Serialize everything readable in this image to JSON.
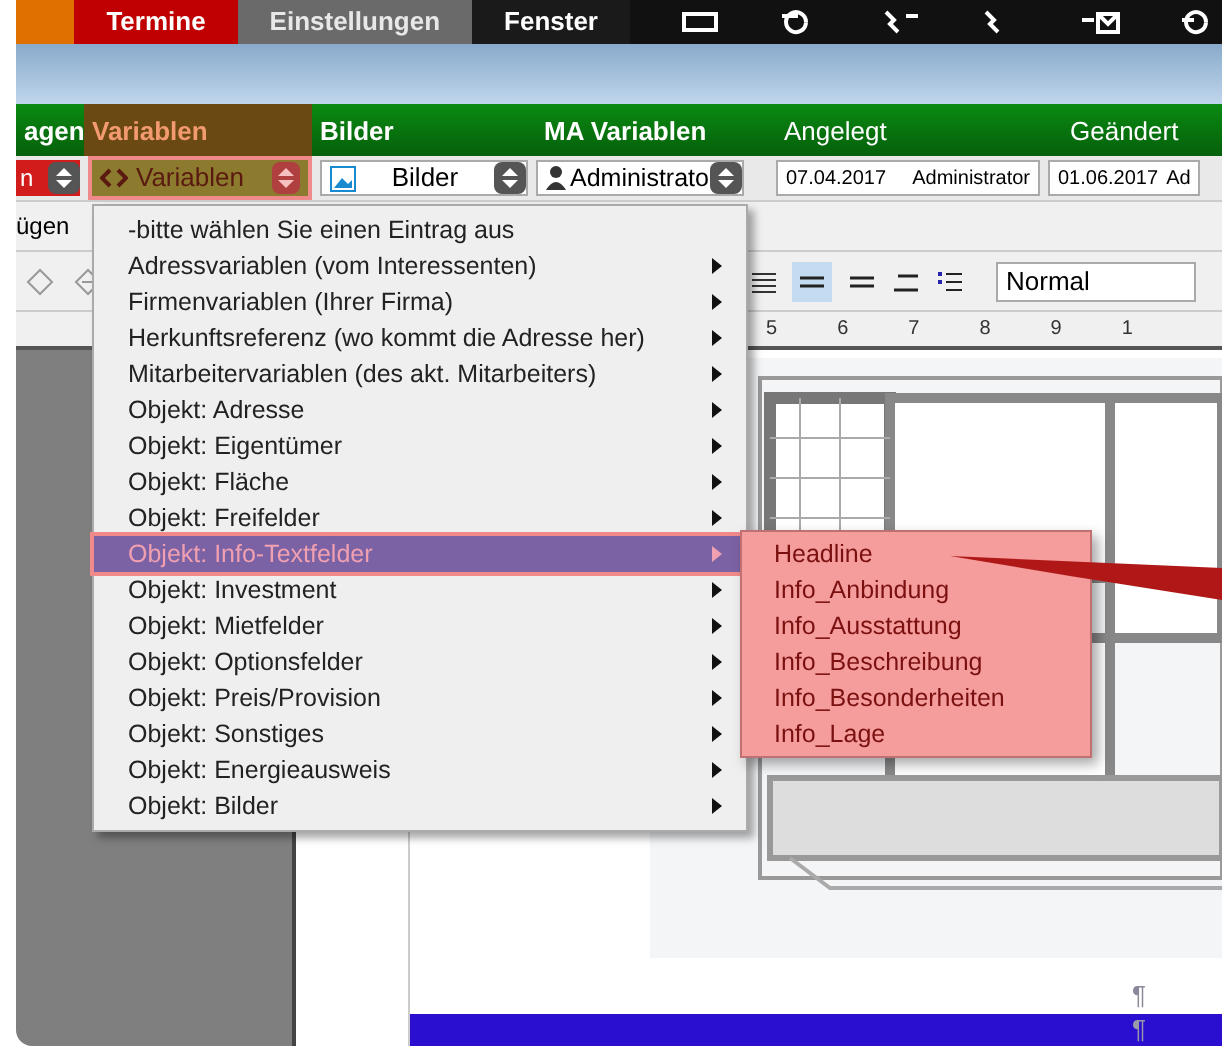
{
  "top_tabs": [
    {
      "label": "Termine",
      "kind": "red"
    },
    {
      "label": "Einstellungen",
      "kind": "gray"
    },
    {
      "label": "Fenster",
      "kind": "dark"
    }
  ],
  "column_headers": [
    {
      "label": "agen",
      "selected": false
    },
    {
      "label": "Variablen",
      "selected": true
    },
    {
      "label": "Bilder",
      "selected": false
    },
    {
      "label": "MA Variablen",
      "selected": false
    },
    {
      "label": "Angelegt",
      "selected": false
    },
    {
      "label": "Geändert",
      "selected": false
    }
  ],
  "controls": {
    "first_select": "n",
    "variables_select": "Variablen",
    "images_select": "Bilder",
    "staff_select": "Administrato",
    "created_date": "07.04.2017",
    "created_by": "Administrator",
    "changed_date": "01.06.2017",
    "changed_by": "Ad"
  },
  "toolbar": {
    "insert_label": "ügen",
    "style_field": "Normal",
    "ruler_marks": [
      "5",
      "6",
      "7",
      "8",
      "9",
      "1"
    ]
  },
  "menu": [
    {
      "label": "-bitte wählen Sie einen Eintrag aus",
      "has_submenu": false,
      "selected": false
    },
    {
      "label": "Adressvariablen (vom Interessenten)",
      "has_submenu": true,
      "selected": false
    },
    {
      "label": "Firmenvariablen (Ihrer Firma)",
      "has_submenu": true,
      "selected": false
    },
    {
      "label": "Herkunftsreferenz (wo kommt die Adresse her)",
      "has_submenu": true,
      "selected": false
    },
    {
      "label": "Mitarbeitervariablen (des akt. Mitarbeiters)",
      "has_submenu": true,
      "selected": false
    },
    {
      "label": "Objekt: Adresse",
      "has_submenu": true,
      "selected": false
    },
    {
      "label": "Objekt: Eigentümer",
      "has_submenu": true,
      "selected": false
    },
    {
      "label": "Objekt: Fläche",
      "has_submenu": true,
      "selected": false
    },
    {
      "label": "Objekt: Freifelder",
      "has_submenu": true,
      "selected": false
    },
    {
      "label": "Objekt: Info-Textfelder",
      "has_submenu": true,
      "selected": true
    },
    {
      "label": "Objekt: Investment",
      "has_submenu": true,
      "selected": false
    },
    {
      "label": "Objekt: Mietfelder",
      "has_submenu": true,
      "selected": false
    },
    {
      "label": "Objekt: Optionsfelder",
      "has_submenu": true,
      "selected": false
    },
    {
      "label": "Objekt: Preis/Provision",
      "has_submenu": true,
      "selected": false
    },
    {
      "label": "Objekt: Sonstiges",
      "has_submenu": true,
      "selected": false
    },
    {
      "label": "Objekt: Energieausweis",
      "has_submenu": true,
      "selected": false
    },
    {
      "label": "Objekt: Bilder",
      "has_submenu": true,
      "selected": false
    }
  ],
  "submenu": [
    "Headline",
    "Info_Anbindung",
    "Info_Ausstattung",
    "Info_Beschreibung",
    "Info_Besonderheiten",
    "Info_Lage"
  ],
  "document": {
    "floor_plan": {
      "kind": "picture"
    },
    "paragraph_marks": [
      "¶",
      "¶"
    ]
  }
}
